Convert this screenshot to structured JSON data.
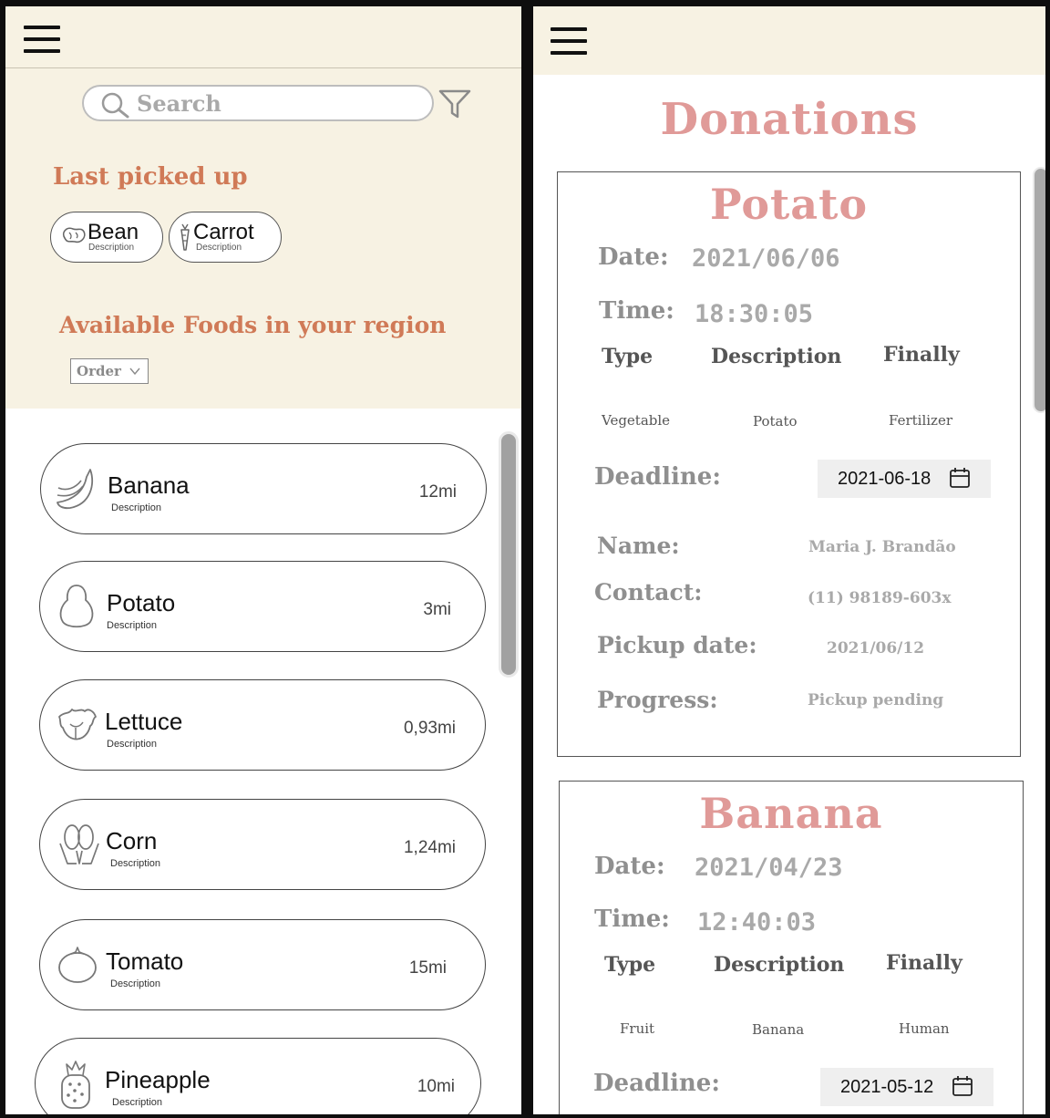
{
  "left": {
    "search_placeholder": "Search",
    "last_picked_title": "Last picked up",
    "last_picked": [
      {
        "name": "Bean",
        "desc": "Description",
        "icon": "bean-icon"
      },
      {
        "name": "Carrot",
        "desc": "Description",
        "icon": "carrot-icon"
      }
    ],
    "available_title": "Available Foods in your region",
    "order_label": "Order",
    "foods": [
      {
        "name": "Banana",
        "desc": "Description",
        "distance": "12mi",
        "icon": "banana-icon"
      },
      {
        "name": "Potato",
        "desc": "Description",
        "distance": "3mi",
        "icon": "potato-icon"
      },
      {
        "name": "Lettuce",
        "desc": "Description",
        "distance": "0,93mi",
        "icon": "lettuce-icon"
      },
      {
        "name": "Corn",
        "desc": "Description",
        "distance": "1,24mi",
        "icon": "corn-icon"
      },
      {
        "name": "Tomato",
        "desc": "Description",
        "distance": "15mi",
        "icon": "tomato-icon"
      },
      {
        "name": "Pineapple",
        "desc": "Description",
        "distance": "10mi",
        "icon": "pineapple-icon"
      }
    ]
  },
  "right": {
    "title": "Donations",
    "labels": {
      "date": "Date:",
      "time": "Time:",
      "type": "Type",
      "description": "Description",
      "finally": "Finally",
      "deadline": "Deadline:",
      "name": "Name:",
      "contact": "Contact:",
      "pickup_date": "Pickup date:",
      "progress": "Progress:"
    },
    "donations": [
      {
        "name": "Potato",
        "date": "2021/06/06",
        "time": "18:30:05",
        "type": "Vegetable",
        "description": "Potato",
        "finally": "Fertilizer",
        "deadline": "2021-06-18",
        "person_name": "Maria J. Brandão",
        "contact": "(11) 98189-603x",
        "pickup_date": "2021/06/12",
        "progress": "Pickup pending"
      },
      {
        "name": "Banana",
        "date": "2021/04/23",
        "time": "12:40:03",
        "type": "Fruit",
        "description": "Banana",
        "finally": "Human",
        "deadline": "2021-05-12"
      }
    ]
  },
  "colors": {
    "header_bg": "#f7f2e3",
    "section_title": "#d07a57",
    "donation_title": "#e09a98"
  }
}
